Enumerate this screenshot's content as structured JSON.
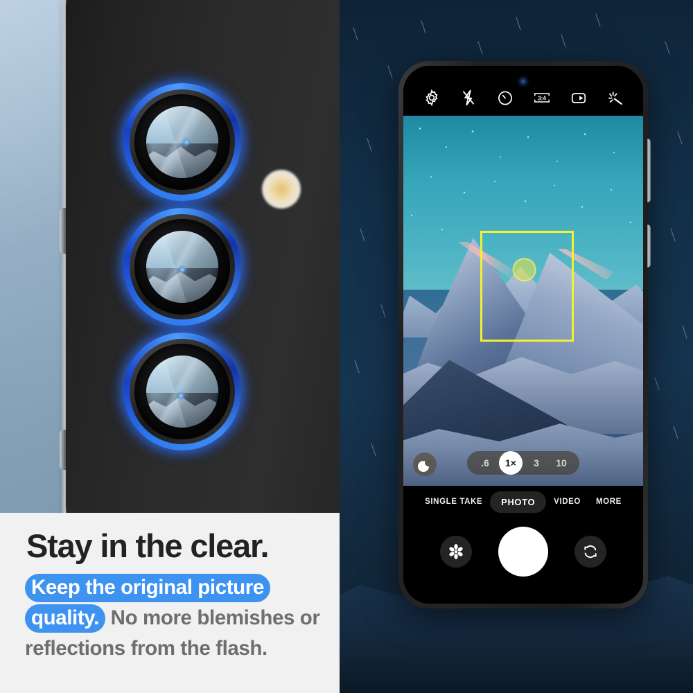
{
  "marketing": {
    "headline": "Stay in the clear.",
    "highlight_line1": "Keep the original picture",
    "highlight_line2": "quality.",
    "body_rest": " No more blemishes or reflections from the flash.",
    "highlight_color": "#3d93ef",
    "headline_color": "#222224",
    "body_color": "#6d6e70",
    "background_color": "#f1f1f1"
  },
  "product": {
    "name": "camera-lens-protector",
    "lens_ring_color": "#2f7bf0",
    "phone_body_color": "#2b2b2c",
    "lens_count": 3,
    "flash_color": "#e8c169",
    "panel_background": "#a3bacd"
  },
  "camera_app": {
    "top_bar": [
      {
        "icon": "settings-gear-icon",
        "label": "Settings"
      },
      {
        "icon": "flash-off-icon",
        "label": "Flash off"
      },
      {
        "icon": "timer-icon",
        "label": "Timer"
      },
      {
        "icon": "aspect-ratio-icon",
        "label": "3:4"
      },
      {
        "icon": "motion-photo-icon",
        "label": "Motion photo"
      },
      {
        "icon": "filters-icon",
        "label": "Filters"
      }
    ],
    "aspect_ratio": "3:4",
    "zoom_levels": [
      {
        "label": ".6",
        "selected": false
      },
      {
        "label": "1×",
        "selected": true
      },
      {
        "label": "3",
        "selected": false
      },
      {
        "label": "10",
        "selected": false
      }
    ],
    "modes": [
      {
        "label": "SINGLE TAKE",
        "selected": false
      },
      {
        "label": "PHOTO",
        "selected": true
      },
      {
        "label": "VIDEO",
        "selected": false
      },
      {
        "label": "MORE",
        "selected": false
      }
    ],
    "controls": {
      "gallery": "gallery-flower-icon",
      "shutter": "shutter-button",
      "flip": "camera-flip-icon"
    },
    "focus_box_color": "#f2f132",
    "scene": "snowy mountain peaks at night"
  }
}
